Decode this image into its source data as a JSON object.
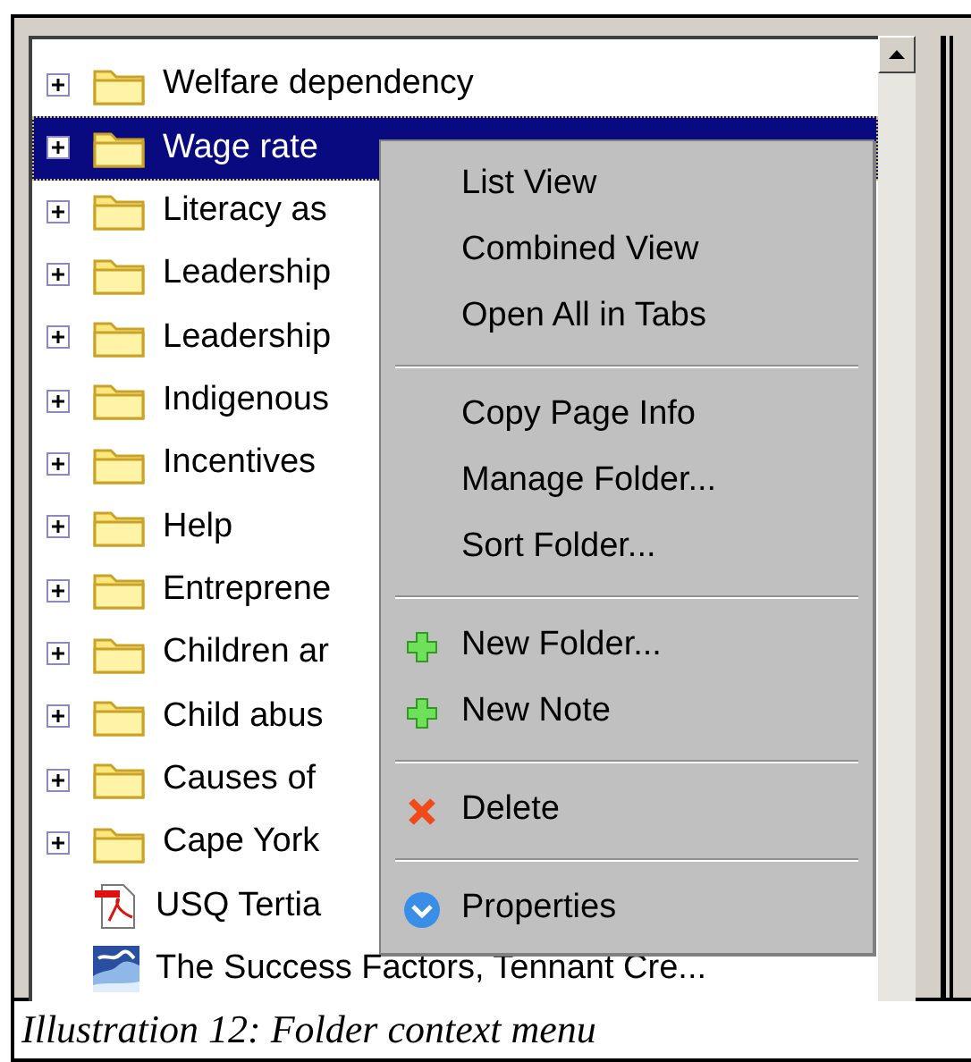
{
  "tree": [
    {
      "kind": "folder",
      "label": "Welfare dependency",
      "selected": false
    },
    {
      "kind": "folder",
      "label": "Wage rate",
      "selected": true
    },
    {
      "kind": "folder",
      "label": "Literacy as",
      "selected": false
    },
    {
      "kind": "folder",
      "label": "Leadership",
      "selected": false
    },
    {
      "kind": "folder",
      "label": "Leadership",
      "selected": false
    },
    {
      "kind": "folder",
      "label": "Indigenous",
      "selected": false
    },
    {
      "kind": "folder",
      "label": "Incentives",
      "selected": false
    },
    {
      "kind": "folder",
      "label": "Help",
      "selected": false
    },
    {
      "kind": "folder",
      "label": "Entreprene",
      "selected": false
    },
    {
      "kind": "folder",
      "label": "Children ar",
      "selected": false
    },
    {
      "kind": "folder",
      "label": "Child abus",
      "selected": false
    },
    {
      "kind": "folder",
      "label": "Causes of",
      "selected": false
    },
    {
      "kind": "folder",
      "label": "Cape York",
      "selected": false
    },
    {
      "kind": "pdf",
      "label": "USQ Tertia",
      "selected": false
    },
    {
      "kind": "page",
      "label": "The Success Factors, Tennant Cre...",
      "selected": false
    }
  ],
  "context_menu": [
    {
      "kind": "item",
      "label": "List View"
    },
    {
      "kind": "item",
      "label": "Combined View"
    },
    {
      "kind": "item",
      "label": "Open All in Tabs"
    },
    {
      "kind": "separator"
    },
    {
      "kind": "item",
      "label": "Copy Page Info"
    },
    {
      "kind": "item",
      "label": "Manage Folder..."
    },
    {
      "kind": "item",
      "label": "Sort Folder..."
    },
    {
      "kind": "separator"
    },
    {
      "kind": "new",
      "label": "New Folder..."
    },
    {
      "kind": "new",
      "label": "New Note"
    },
    {
      "kind": "separator"
    },
    {
      "kind": "delete",
      "label": "Delete"
    },
    {
      "kind": "separator"
    },
    {
      "kind": "properties",
      "label": "Properties"
    }
  ],
  "caption": "Illustration 12: Folder context menu"
}
